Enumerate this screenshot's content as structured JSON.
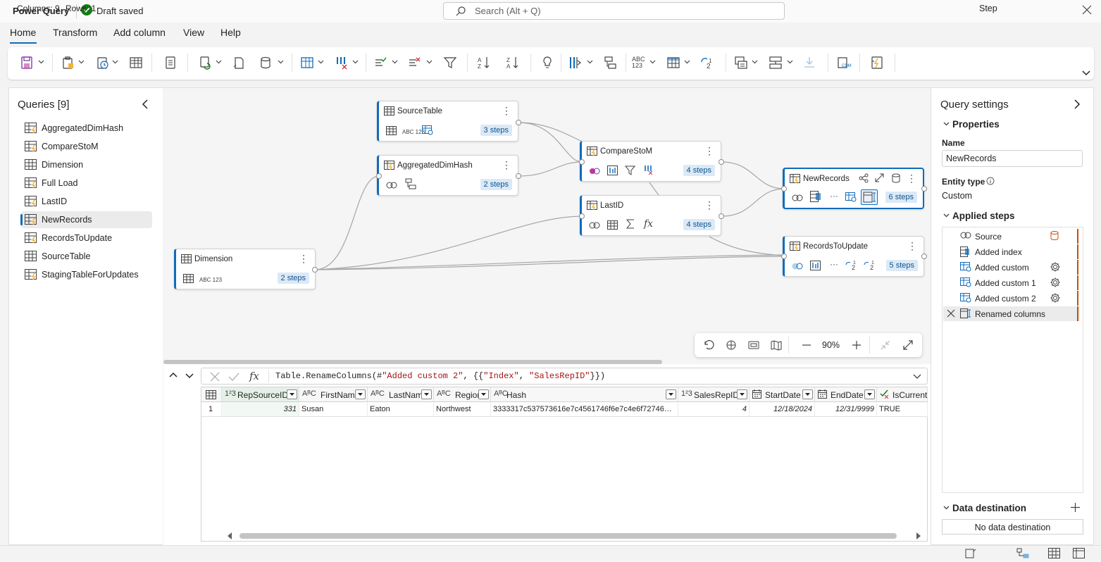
{
  "titlebar": {
    "app_title": "Power Query",
    "status": "Draft saved",
    "search_placeholder": "Search (Alt + Q)"
  },
  "menu": {
    "tabs": [
      "Home",
      "Transform",
      "Add column",
      "View",
      "Help"
    ],
    "active": "Home"
  },
  "ribbon": {
    "ribbon_badge_text": "ABC\n123"
  },
  "queries": {
    "title": "Queries [9]",
    "items": [
      {
        "label": "AggregatedDimHash",
        "icon": "lightning-table-icon"
      },
      {
        "label": "CompareStoM",
        "icon": "lightning-table-icon"
      },
      {
        "label": "Dimension",
        "icon": "table-icon"
      },
      {
        "label": "Full Load",
        "icon": "lightning-table-icon"
      },
      {
        "label": "LastID",
        "icon": "lightning-table-icon"
      },
      {
        "label": "NewRecords",
        "icon": "lightning-table-icon"
      },
      {
        "label": "RecordsToUpdate",
        "icon": "lightning-table-icon"
      },
      {
        "label": "SourceTable",
        "icon": "table-icon"
      },
      {
        "label": "StagingTableForUpdates",
        "icon": "lightning-table-icon"
      }
    ],
    "selected": "NewRecords"
  },
  "diagram": {
    "cards": {
      "source_table": {
        "title": "SourceTable",
        "steps": "3 steps",
        "badge": "ABC 123"
      },
      "aggregated": {
        "title": "AggregatedDimHash",
        "steps": "2 steps"
      },
      "compare": {
        "title": "CompareStoM",
        "steps": "4 steps"
      },
      "lastid": {
        "title": "LastID",
        "steps": "4 steps"
      },
      "dimension": {
        "title": "Dimension",
        "steps": "2 steps",
        "badge": "ABC 123"
      },
      "newrecords": {
        "title": "NewRecords",
        "steps": "6 steps"
      },
      "recordstoupdate": {
        "title": "RecordsToUpdate",
        "steps": "5 steps"
      }
    },
    "zoom": "90%"
  },
  "formula": {
    "prefix": "Table.RenameColumns(#",
    "arg1": "\"Added custom 2\"",
    "mid": ", {{",
    "arg2": "\"Index\"",
    "comma": ", ",
    "arg3": "\"SalesRepID\"",
    "suffix": "}})"
  },
  "grid": {
    "columns": [
      {
        "type": "1²3",
        "label": "RepSourceID"
      },
      {
        "type": "A^B_C",
        "label": "FirstName"
      },
      {
        "type": "A^B_C",
        "label": "LastName"
      },
      {
        "type": "A^B_C",
        "label": "Region"
      },
      {
        "type": "A^B_C",
        "label": "Hash"
      },
      {
        "type": "1²3",
        "label": "SalesRepID"
      },
      {
        "type": "calendar",
        "label": "StartDate"
      },
      {
        "type": "calendar",
        "label": "EndDate"
      },
      {
        "type": "check",
        "label": "IsCurrent"
      }
    ],
    "rows": [
      {
        "index": "1",
        "cells": [
          "331",
          "Susan",
          "Eaton",
          "Northwest",
          "3333317c537573616e7c4561746f6e7c4e6f7274687...",
          "4",
          "12/18/2024",
          "12/31/9999",
          "TRUE"
        ]
      }
    ]
  },
  "settings": {
    "title": "Query settings",
    "properties_title": "Properties",
    "name_label": "Name",
    "name_value": "NewRecords",
    "entity_type_label": "Entity type",
    "entity_type_value": "Custom",
    "applied_steps_title": "Applied steps",
    "steps": [
      {
        "label": "Source",
        "gear": false
      },
      {
        "label": "Added index",
        "gear": false
      },
      {
        "label": "Added custom",
        "gear": true
      },
      {
        "label": "Added custom 1",
        "gear": true
      },
      {
        "label": "Added custom 2",
        "gear": true
      },
      {
        "label": "Renamed columns",
        "gear": false
      }
    ],
    "data_destination_title": "Data destination",
    "no_destination": "No data destination"
  },
  "status": {
    "columns": "Columns: 9",
    "rows": "Rows: 1",
    "step": "Step"
  },
  "colors": {
    "accent": "#0f6cbd",
    "success": "#107c10",
    "step_bar": "#c75100"
  }
}
